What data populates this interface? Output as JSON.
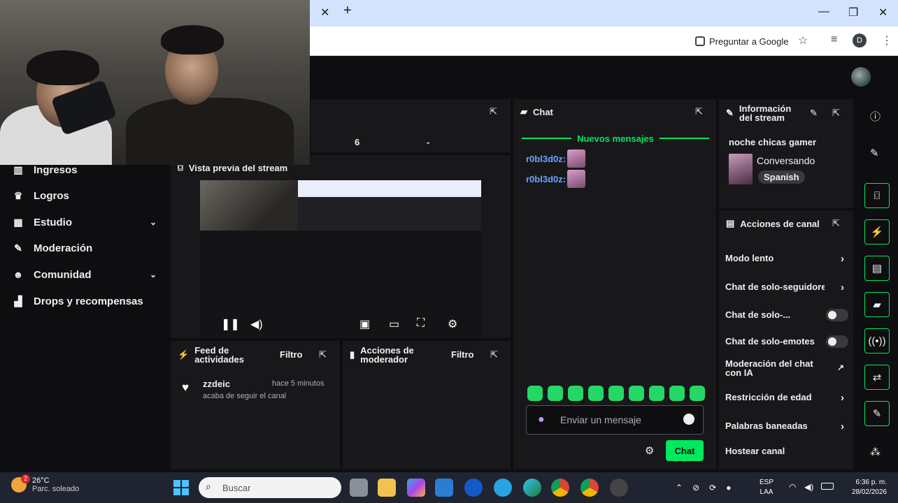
{
  "browser": {
    "ask_google": "Preguntar a Google",
    "profile_initial": "D",
    "tab_close": "✕",
    "tab_add": "+",
    "win_min": "—",
    "win_max": "❐",
    "win_close": "✕"
  },
  "sidebar": {
    "items": [
      {
        "label": "Ingresos",
        "icon": "bar-chart-icon"
      },
      {
        "label": "Logros",
        "icon": "trophy-icon"
      },
      {
        "label": "Estudio",
        "icon": "studio-icon"
      },
      {
        "label": "Moderación",
        "icon": "wrench-icon"
      },
      {
        "label": "Comunidad",
        "icon": "community-icon"
      },
      {
        "label": "Drops y recompensas",
        "icon": "drops-icon"
      }
    ]
  },
  "stats": {
    "value1": "6",
    "value2": "-"
  },
  "preview": {
    "title": "Vista previa del stream"
  },
  "feed": {
    "title": "Feed de actividades",
    "filter": "Filtro",
    "entry": {
      "user": "zzdeic",
      "time": "hace 5 minutos",
      "text": "acaba de seguir el canal"
    }
  },
  "mod_actions": {
    "title": "Acciones de moderador",
    "filter": "Filtro"
  },
  "chat": {
    "title": "Chat",
    "new_messages": "Nuevos mensajes",
    "messages": [
      {
        "user": "r0bl3d0z:"
      },
      {
        "user": "r0bl3d0z:"
      }
    ],
    "placeholder": "Enviar un mensaje",
    "send": "Chat"
  },
  "stream_info": {
    "title": "Información del stream",
    "stream_title": "noche chicas gamer",
    "category": "Conversando",
    "tag": "Spanish"
  },
  "channel_actions": {
    "title": "Acciones de canal",
    "items": [
      {
        "label": "Modo lento",
        "control": "chevron"
      },
      {
        "label": "Chat de solo-seguidores",
        "control": "chevron"
      },
      {
        "label": "Chat de solo-...",
        "control": "toggle",
        "on": false
      },
      {
        "label": "Chat de solo-emotes",
        "control": "toggle",
        "on": false
      },
      {
        "label": "Moderación del chat con IA",
        "control": "external"
      },
      {
        "label": "Restricción de edad",
        "control": "chevron"
      },
      {
        "label": "Palabras baneadas",
        "control": "chevron"
      },
      {
        "label": "Hostear canal",
        "control": "none"
      }
    ]
  },
  "taskbar": {
    "weather_temp": "26°C",
    "weather_desc": "Parc. soleado",
    "weather_badge": "2",
    "search": "Buscar",
    "lang1": "ESP",
    "lang2": "LAA",
    "time": "6:36 p. m.",
    "date": "28/02/2026"
  },
  "colors": {
    "accent": "#00e85f",
    "username": "#6aa4ff",
    "panel": "#18181b",
    "bg": "#0e0e10"
  }
}
